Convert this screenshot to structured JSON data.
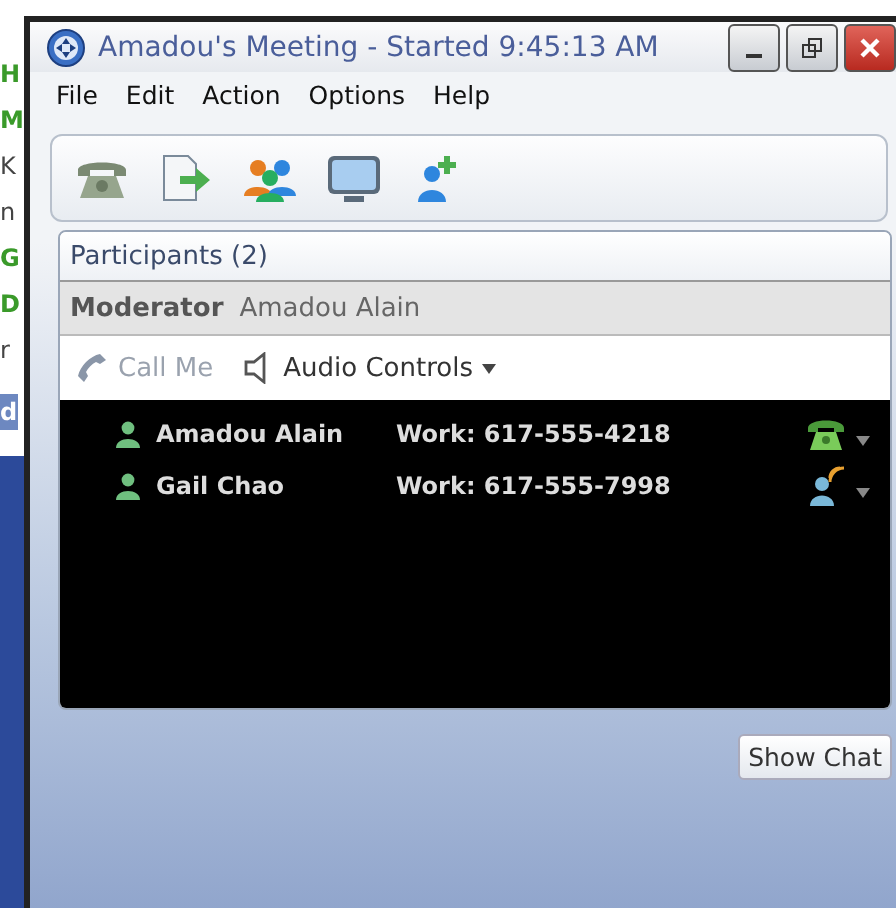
{
  "background_window": {
    "fragments": [
      {
        "text": "H",
        "kind": "green"
      },
      {
        "text": "M",
        "kind": "green"
      },
      {
        "text": "K",
        "kind": "plain"
      },
      {
        "text": "n",
        "kind": "plain"
      },
      {
        "text": "G",
        "kind": "green"
      },
      {
        "text": "D",
        "kind": "green"
      },
      {
        "text": "r",
        "kind": "plain"
      },
      {
        "text": "d",
        "kind": "button"
      }
    ]
  },
  "window": {
    "title": "Amadou's Meeting - Started 9:45:13 AM"
  },
  "menu": [
    "File",
    "Edit",
    "Action",
    "Options",
    "Help"
  ],
  "participants": {
    "title": "Participants (2)",
    "moderator_label": "Moderator",
    "moderator_name": "Amadou Alain",
    "call_me": {
      "label": "Call Me",
      "disabled": true
    },
    "audio_controls": "Audio Controls",
    "rows": [
      {
        "name": "Amadou Alain",
        "phone": "Work: 617-555-4218",
        "kind": "phone"
      },
      {
        "name": "Gail Chao",
        "phone": "Work: 617-555-7998",
        "kind": "speaking"
      }
    ]
  },
  "show_chat": "Show Chat"
}
